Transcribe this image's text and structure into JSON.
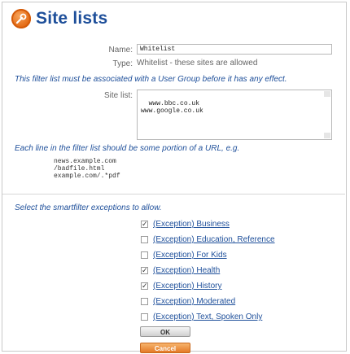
{
  "page": {
    "title": "Site lists"
  },
  "form": {
    "name_label": "Name:",
    "name_value": "Whitelist",
    "type_label": "Type:",
    "type_value": "Whitelist - these sites are allowed",
    "association_note": "This filter list must be associated with a User Group before it has any effect.",
    "site_list_label": "Site list:",
    "site_list_value": "www.bbc.co.uk\nwww.google.co.uk",
    "url_note": "Each line in the filter list should be some portion of a URL, e.g.",
    "examples": [
      "news.example.com",
      "/badfile.html",
      "example.com/.*pdf"
    ],
    "exceptions_note": "Select the smartfilter exceptions to allow."
  },
  "exceptions": [
    {
      "label": "(Exception) Business",
      "checked": true
    },
    {
      "label": "(Exception) Education, Reference",
      "checked": false
    },
    {
      "label": "(Exception) For Kids",
      "checked": false
    },
    {
      "label": "(Exception) Health",
      "checked": true
    },
    {
      "label": "(Exception) History",
      "checked": true
    },
    {
      "label": "(Exception) Moderated",
      "checked": false
    },
    {
      "label": "(Exception) Text, Spoken Only",
      "checked": false
    }
  ],
  "buttons": {
    "ok": "OK",
    "cancel": "Cancel"
  },
  "colors": {
    "heading": "#1e4f9a",
    "accent_orange": "#e37a26"
  },
  "icons": {
    "logo": "wrench-gear-icon"
  }
}
